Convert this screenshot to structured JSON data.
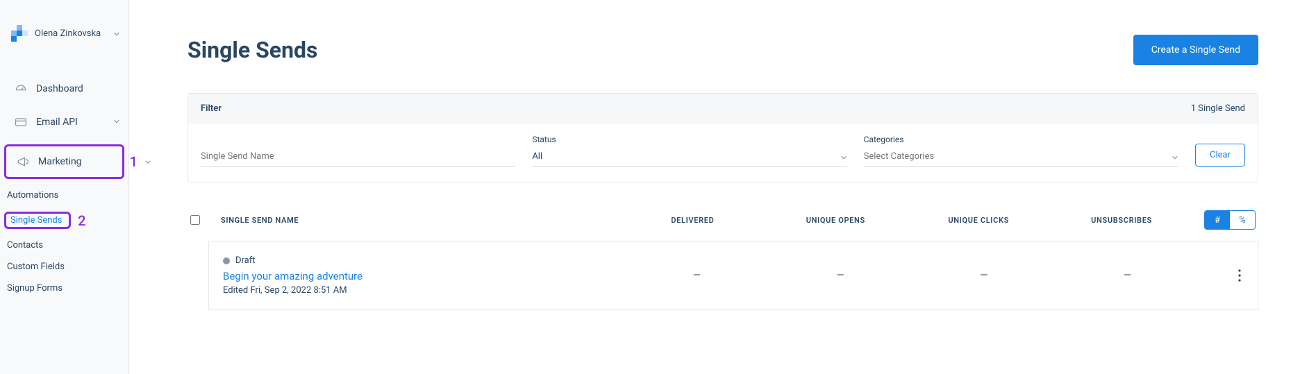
{
  "sidebar": {
    "user_name": "Olena Zinkovska",
    "items": {
      "dashboard": "Dashboard",
      "email_api": "Email API",
      "marketing": "Marketing"
    },
    "marketing_sub": {
      "automations": "Automations",
      "single_sends": "Single Sends",
      "contacts": "Contacts",
      "custom_fields": "Custom Fields",
      "signup_forms": "Signup Forms"
    },
    "annotations": {
      "one": "1",
      "two": "2"
    }
  },
  "page": {
    "title": "Single Sends",
    "primary_button": "Create a Single Send"
  },
  "filter": {
    "title": "Filter",
    "count_text": "1 Single Send",
    "name_placeholder": "Single Send Name",
    "status_label": "Status",
    "status_value": "All",
    "categories_label": "Categories",
    "categories_placeholder": "Select Categories",
    "clear": "Clear"
  },
  "table": {
    "headers": {
      "name": "Single Send Name",
      "delivered": "Delivered",
      "unique_opens": "Unique Opens",
      "unique_clicks": "Unique Clicks",
      "unsubscribes": "Unsubscribes"
    },
    "toggle": {
      "hash": "#",
      "pct": "%"
    },
    "rows": [
      {
        "status": "Draft",
        "title": "Begin your amazing adventure",
        "meta": "Edited Fri, Sep 2, 2022 8:51 AM",
        "delivered": "—",
        "unique_opens": "—",
        "unique_clicks": "—",
        "unsubscribes": "—"
      }
    ]
  }
}
